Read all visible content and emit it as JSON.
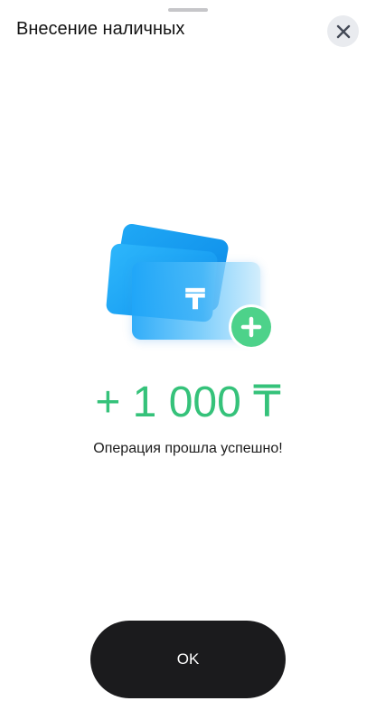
{
  "header": {
    "title": "Внесение наличных",
    "close_icon": "close-icon"
  },
  "illustration": {
    "currency_symbol": "₸",
    "badge_icon": "plus-icon",
    "colors": {
      "card": "#1fa8f5",
      "badge": "#4dd28a"
    }
  },
  "result": {
    "amount": "+ 1 000 ₸",
    "amount_color": "#35c27a",
    "message": "Операция прошла успешно!"
  },
  "actions": {
    "ok_label": "OK"
  }
}
